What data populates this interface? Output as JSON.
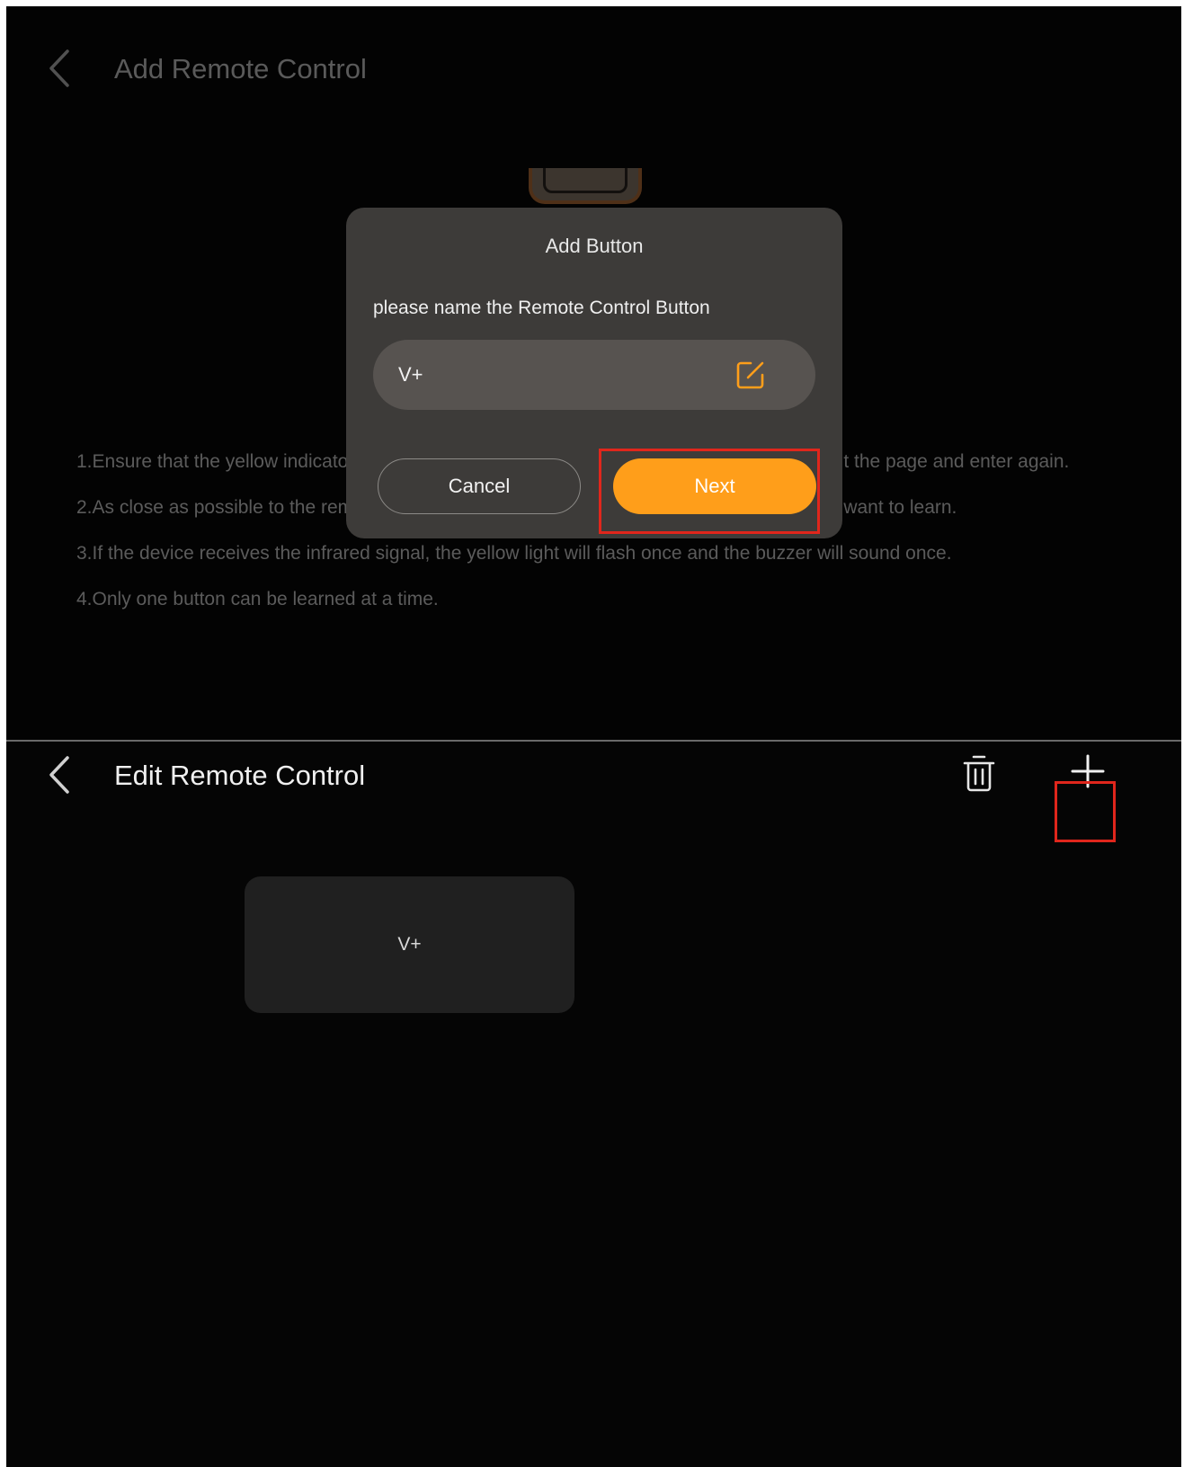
{
  "add_screen": {
    "title": "Add Remote Control",
    "instructions": [
      "1.Ensure that the yellow indicator light flashes during learning. If it does not flash, please exit the page and enter again.",
      "2.As close as possible to the remote control and press the button on the remote control you want to learn.",
      "3.If the device receives the infrared signal, the yellow light will flash once and the buzzer will sound once.",
      "4.Only one button can be learned at a time."
    ],
    "dialog": {
      "title": "Add Button",
      "prompt": "please name the Remote Control Button",
      "input_value": "V+",
      "cancel_label": "Cancel",
      "next_label": "Next"
    }
  },
  "edit_screen": {
    "title": "Edit Remote Control",
    "buttons": [
      "V+"
    ]
  },
  "icons": {
    "back": "chevron-left-icon",
    "edit": "edit-icon",
    "delete": "trash-icon",
    "add": "plus-icon"
  },
  "colors": {
    "background": "#050505",
    "dialog": "#3d3b39",
    "accent": "#ff9e1a",
    "highlight": "#e0261c"
  }
}
